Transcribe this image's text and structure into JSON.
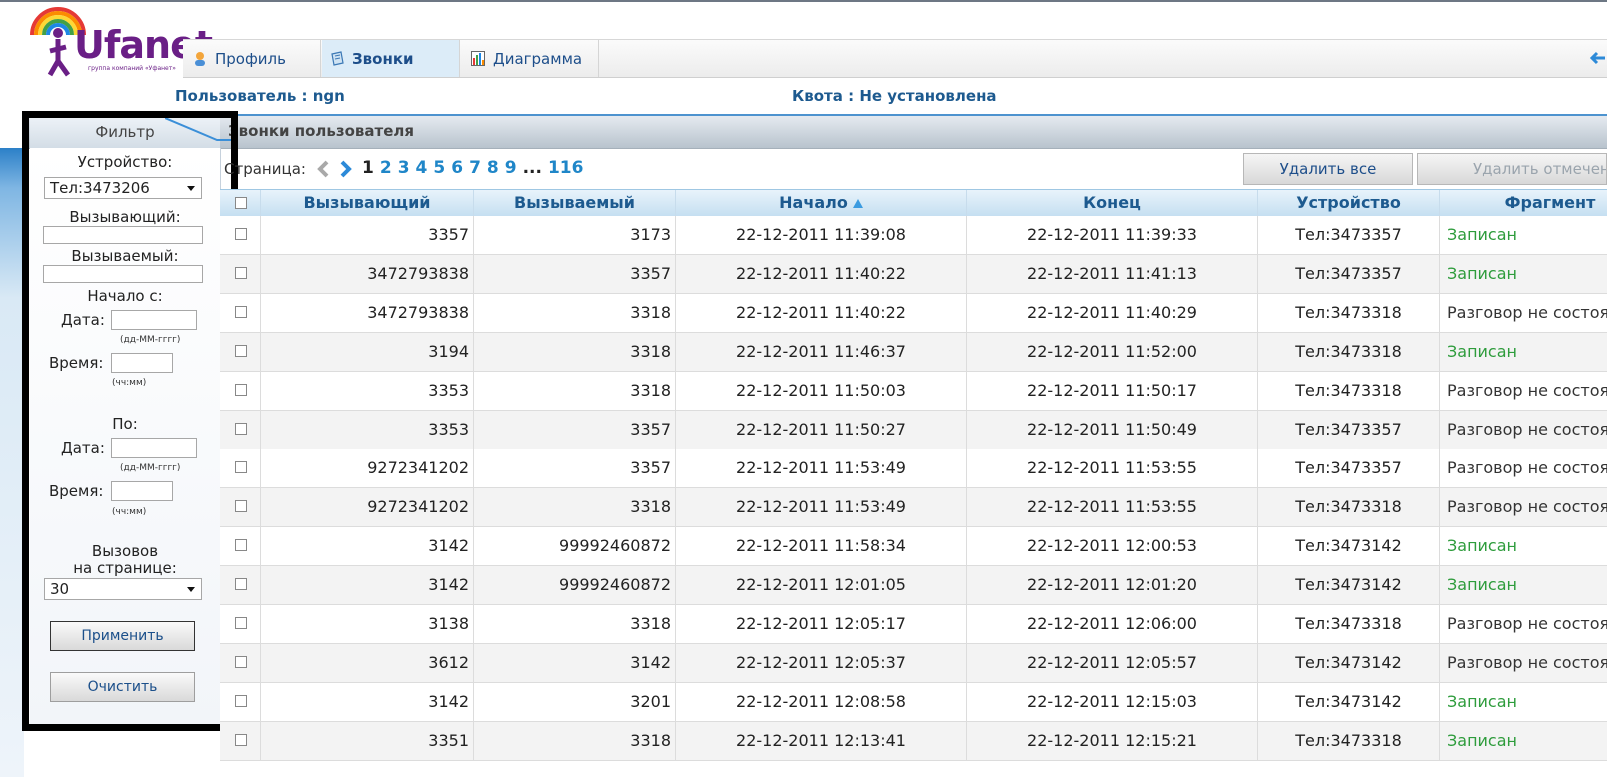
{
  "brand": {
    "logo_text": "Ufanet",
    "logo_tagline": "группа компаний «Уфанет»"
  },
  "tabs": [
    {
      "label": "Профиль",
      "icon": "profile-icon",
      "active": false
    },
    {
      "label": "Звонки",
      "icon": "calls-icon",
      "active": true
    },
    {
      "label": "Диаграмма",
      "icon": "chart-icon",
      "active": false
    }
  ],
  "user_line": "Пользователь : ngn",
  "quota_line": "Квота : Не установлена",
  "section": {
    "filter_tab": "Фильтр",
    "title": "Звонки пользователя"
  },
  "filter": {
    "device_label": "Устройство:",
    "device_value": "Тел:3473206",
    "caller_label": "Вызывающий:",
    "callee_label": "Вызываемый:",
    "from_label": "Начало с:",
    "to_label": "По:",
    "date_label": "Дата:",
    "time_label": "Время:",
    "date_hint": "(дд-ММ-гггг)",
    "time_hint": "(чч:мм)",
    "per_page_label_1": "Вызовов",
    "per_page_label_2": "на странице:",
    "per_page_value": "30",
    "apply_label": "Применить",
    "clear_label": "Очистить"
  },
  "pager": {
    "label": "Страница:",
    "current": "1",
    "pages": [
      "2",
      "3",
      "4",
      "5",
      "6",
      "7",
      "8",
      "9"
    ],
    "ellipsis": "...",
    "last": "116"
  },
  "actions": {
    "delete_all": "Удалить все",
    "delete_selected": "Удалить отмеченные"
  },
  "table": {
    "columns": [
      "Вызывающий",
      "Вызываемый",
      "Начало",
      "Конец",
      "Устройство",
      "Фрагмент"
    ],
    "rows": [
      {
        "caller": "3357",
        "callee": "3173",
        "start": "22-12-2011 11:39:08",
        "end": "22-12-2011 11:39:33",
        "device": "Тел:3473357",
        "fragment": "Записан",
        "ok": true
      },
      {
        "caller": "3472793838",
        "callee": "3357",
        "start": "22-12-2011 11:40:22",
        "end": "22-12-2011 11:41:13",
        "device": "Тел:3473357",
        "fragment": "Записан",
        "ok": true
      },
      {
        "caller": "3472793838",
        "callee": "3318",
        "start": "22-12-2011 11:40:22",
        "end": "22-12-2011 11:40:29",
        "device": "Тел:3473318",
        "fragment": "Разговор не состоялся",
        "ok": false
      },
      {
        "caller": "3194",
        "callee": "3318",
        "start": "22-12-2011 11:46:37",
        "end": "22-12-2011 11:52:00",
        "device": "Тел:3473318",
        "fragment": "Записан",
        "ok": true
      },
      {
        "caller": "3353",
        "callee": "3318",
        "start": "22-12-2011 11:50:03",
        "end": "22-12-2011 11:50:17",
        "device": "Тел:3473318",
        "fragment": "Разговор не состоялся",
        "ok": false
      },
      {
        "caller": "3353",
        "callee": "3357",
        "start": "22-12-2011 11:50:27",
        "end": "22-12-2011 11:50:49",
        "device": "Тел:3473357",
        "fragment": "Разговор не состоялся",
        "ok": false
      },
      {
        "caller": "9272341202",
        "callee": "3357",
        "start": "22-12-2011 11:53:49",
        "end": "22-12-2011 11:53:55",
        "device": "Тел:3473357",
        "fragment": "Разговор не состоялся",
        "ok": false
      },
      {
        "caller": "9272341202",
        "callee": "3318",
        "start": "22-12-2011 11:53:49",
        "end": "22-12-2011 11:53:55",
        "device": "Тел:3473318",
        "fragment": "Разговор не состоялся",
        "ok": false
      },
      {
        "caller": "3142",
        "callee": "99992460872",
        "start": "22-12-2011 11:58:34",
        "end": "22-12-2011 12:00:53",
        "device": "Тел:3473142",
        "fragment": "Записан",
        "ok": true
      },
      {
        "caller": "3142",
        "callee": "99992460872",
        "start": "22-12-2011 12:01:05",
        "end": "22-12-2011 12:01:20",
        "device": "Тел:3473142",
        "fragment": "Записан",
        "ok": true
      },
      {
        "caller": "3138",
        "callee": "3318",
        "start": "22-12-2011 12:05:17",
        "end": "22-12-2011 12:06:00",
        "device": "Тел:3473318",
        "fragment": "Разговор не состоялся",
        "ok": false
      },
      {
        "caller": "3612",
        "callee": "3142",
        "start": "22-12-2011 12:05:37",
        "end": "22-12-2011 12:05:57",
        "device": "Тел:3473142",
        "fragment": "Разговор не состоялся",
        "ok": false
      },
      {
        "caller": "3142",
        "callee": "3201",
        "start": "22-12-2011 12:08:58",
        "end": "22-12-2011 12:15:03",
        "device": "Тел:3473142",
        "fragment": "Записан",
        "ok": true
      },
      {
        "caller": "3351",
        "callee": "3318",
        "start": "22-12-2011 12:13:41",
        "end": "22-12-2011 12:15:21",
        "device": "Тел:3473318",
        "fragment": "Записан",
        "ok": true
      }
    ]
  },
  "colors": {
    "accent": "#1d5a8f",
    "link": "#1f86c8",
    "ok": "#2e9c3c"
  }
}
